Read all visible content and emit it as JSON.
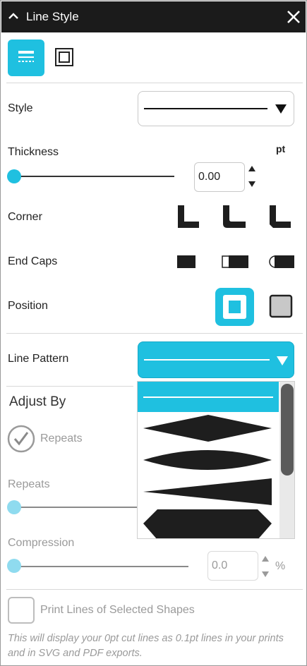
{
  "title": "Line Style",
  "tabs": {
    "active": "line-style-tab",
    "inactive": "outline-tab"
  },
  "labels": {
    "style": "Style",
    "thickness": "Thickness",
    "thickness_unit": "pt",
    "corner": "Corner",
    "end_caps": "End Caps",
    "position": "Position",
    "line_pattern": "Line Pattern",
    "adjust_by": "Adjust By",
    "repeats_option": "Repeats",
    "repeats": "Repeats",
    "compression": "Compression",
    "compression_unit": "%",
    "print_lines": "Print Lines of Selected Shapes"
  },
  "values": {
    "thickness": "0.00",
    "thickness_slider": 0,
    "repeats_slider": 0,
    "compression": "0.0",
    "compression_slider": 0
  },
  "line_pattern_options": [
    "solid",
    "diamond",
    "lens",
    "taper",
    "hexagon"
  ],
  "line_pattern_selected": "solid",
  "note": "This will display your 0pt cut lines as 0.1pt lines in your prints and in SVG and PDF exports.",
  "colors": {
    "accent": "#1fc0e0",
    "titlebar": "#1b1b1b",
    "muted_text": "#9a9a9a"
  }
}
